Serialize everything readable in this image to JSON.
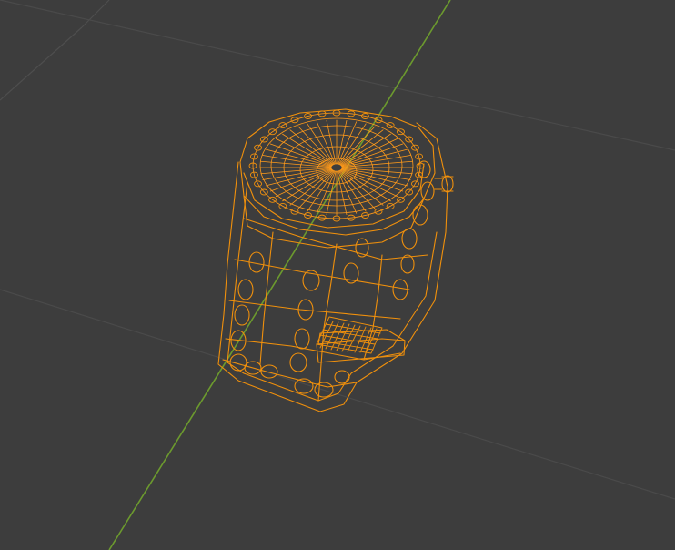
{
  "viewport": {
    "background": "#3d3d3d",
    "grid_line_color": "#4e4e4e",
    "y_axis_color": "#6c9a2e",
    "selected_wire_color": "#f0900c",
    "selected_wire_highlight": "#ffad33"
  },
  "object": {
    "name_hint": "wristwatch-wireframe",
    "display_mode": "wireframe",
    "selected": true
  }
}
